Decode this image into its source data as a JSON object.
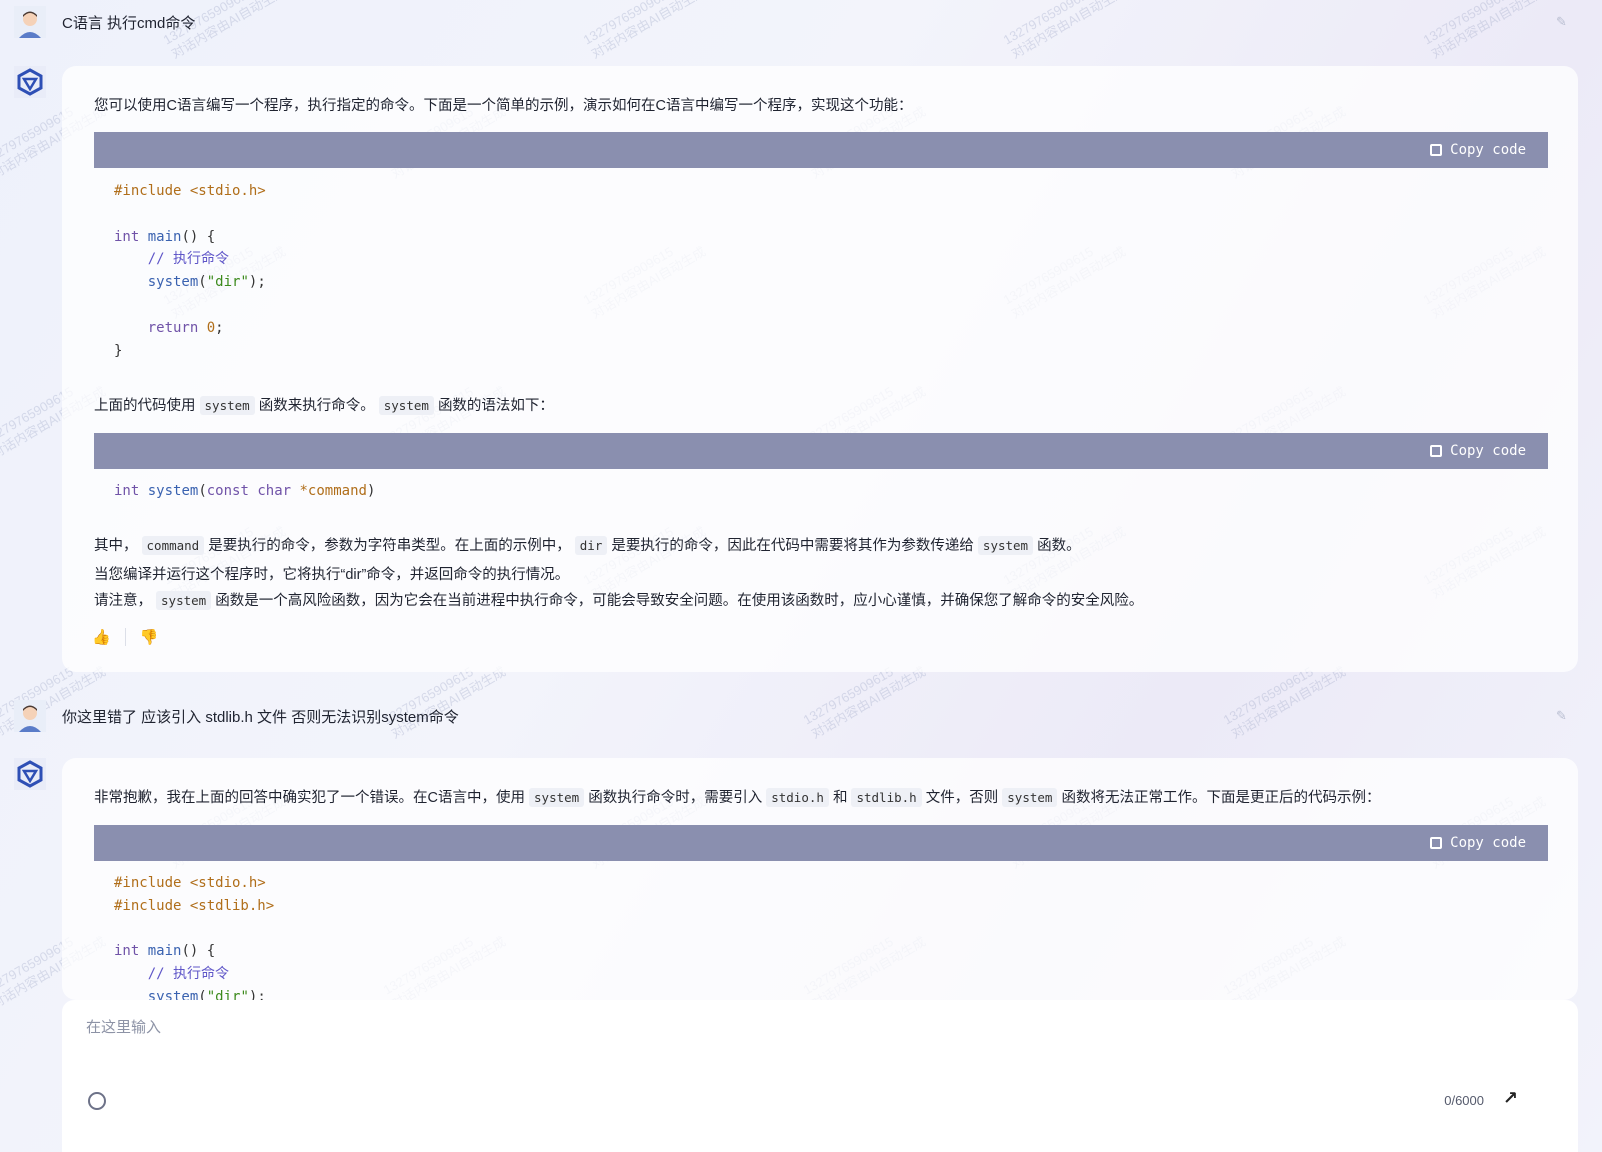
{
  "messages": [
    {
      "role": "user",
      "text": "C语言 执行cmd命令"
    },
    {
      "role": "assistant",
      "intro": "您可以使用C语言编写一个程序，执行指定的命令。下面是一个简单的示例，演示如何在C语言中编写一个程序，实现这个功能：",
      "copy_label": "Copy code",
      "p2_a": "上面的代码使用",
      "p2_code1": "system",
      "p2_b": "函数来执行命令。",
      "p2_code2": "system",
      "p2_c": "函数的语法如下：",
      "p3_a": "其中，",
      "p3_code1": "command",
      "p3_b": "是要执行的命令，参数为字符串类型。在上面的示例中，",
      "p3_code2": "dir",
      "p3_c": "是要执行的命令，因此在代码中需要将其作为参数传递给",
      "p3_code3": "system",
      "p3_d": "函数。",
      "p4": "当您编译并运行这个程序时，它将执行“dir”命令，并返回命令的执行情况。",
      "p5_a": "请注意，",
      "p5_code": "system",
      "p5_b": "函数是一个高风险函数，因为它会在当前进程中执行命令，可能会导致安全问题。在使用该函数时，应小心谨慎，并确保您了解命令的安全风险。"
    },
    {
      "role": "user",
      "text": "你这里错了 应该引入 stdlib.h 文件 否则无法识别system命令"
    },
    {
      "role": "assistant",
      "a": "非常抱歉，我在上面的回答中确实犯了一个错误。在C语言中，使用",
      "c1": "system",
      "b": "函数执行命令时，需要引入",
      "c2": "stdio.h",
      "c": "和",
      "c3": "stdlib.h",
      "d": "文件，否则",
      "c4": "system",
      "e": "函数将无法正常工作。下面是更正后的代码示例："
    }
  ],
  "input": {
    "placeholder": "在这里输入",
    "counter": "0/6000"
  },
  "watermark": {
    "line1": "13279765909615",
    "line2": "对话内容由AI自动生成"
  }
}
